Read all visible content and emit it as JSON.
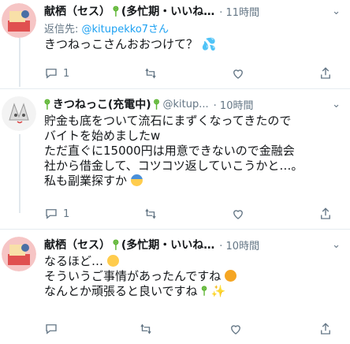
{
  "tweets": [
    {
      "name": "献栖（セス）",
      "name_tail": "(多忙期・いいね…",
      "handle": "",
      "time": "· 11時間",
      "reply_prefix": "返信先: ",
      "reply_mention": "@kitupekko7さん",
      "text_lines": [
        "きつねっこさんおおつけて？"
      ],
      "counts": {
        "reply": "1",
        "retweet": "",
        "like": "",
        "share": ""
      }
    },
    {
      "name": "きつねっこ(充電中)",
      "name_tail": "",
      "handle": "@kitup...",
      "time": "· 10時間",
      "reply_prefix": "",
      "reply_mention": "",
      "text_lines": [
        "貯金も底をついて流石にまずくなってきたので",
        "バイトを始めましたw",
        "ただ直ぐに15000円は用意できないので金融会",
        "社から借金して、コツコツ返していこうかと…。",
        "私も副業探すか"
      ],
      "counts": {
        "reply": "1",
        "retweet": "",
        "like": "",
        "share": ""
      }
    },
    {
      "name": "献栖（セス）",
      "name_tail": "(多忙期・いいね…",
      "handle": "",
      "time": "· 10時間",
      "reply_prefix": "",
      "reply_mention": "",
      "text_lines": [
        "なるほど…",
        "そういうご事情があったんですね",
        "なんとか頑張ると良いですね"
      ],
      "counts": {
        "reply": "",
        "retweet": "",
        "like": "",
        "share": ""
      }
    }
  ],
  "colors": {
    "accent": "#1da1f2",
    "muted": "#657786",
    "text": "#14171a",
    "divider": "#e6ecf0"
  },
  "icons": [
    "reply-icon",
    "retweet-icon",
    "like-icon",
    "share-icon",
    "chevron-down-icon"
  ]
}
